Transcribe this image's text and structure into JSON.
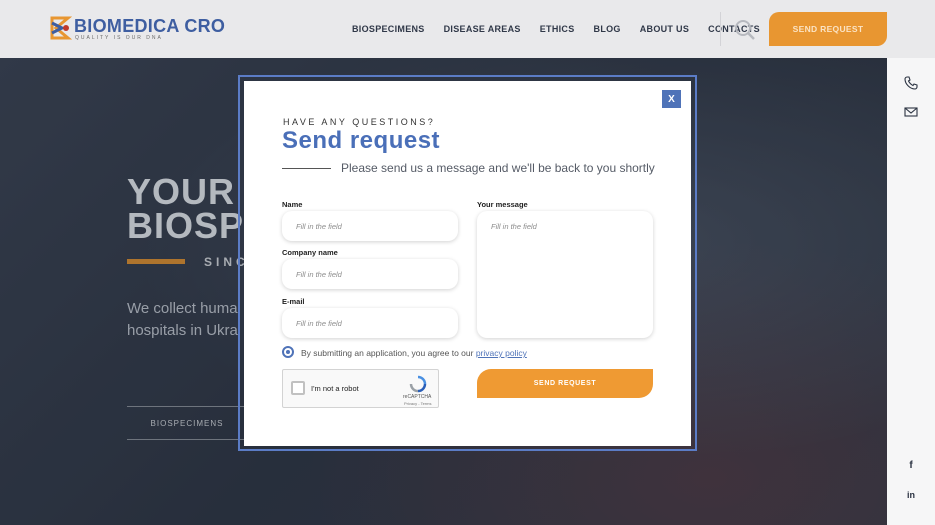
{
  "header": {
    "logo_text": "BIOMEDICA CRO",
    "logo_tagline": "QUALITY IS OUR DNA",
    "nav": [
      "BIOSPECIMENS",
      "DISEASE AREAS",
      "ETHICS",
      "BLOG",
      "ABOUT US",
      "CONTACTS"
    ],
    "send_request_label": "SEND REQUEST"
  },
  "hero": {
    "title_line1": "YOUR",
    "title_line2": "BIOSP",
    "since": "SINC",
    "desc_line1": "We collect huma",
    "desc_line2": "hospitals in Ukra",
    "button_label": "BIOSPECIMENS"
  },
  "rail": {
    "icons": [
      "phone-icon",
      "mail-icon",
      "facebook-icon",
      "linkedin-icon"
    ],
    "facebook_text": "f",
    "linkedin_text": "in"
  },
  "modal": {
    "close_label": "X",
    "eyebrow": "HAVE ANY QUESTIONS?",
    "title": "Send request",
    "subtitle": "Please send us a message and we'll be back to you shortly",
    "fields": {
      "name_label": "Name",
      "name_placeholder": "Fill in the field",
      "company_label": "Company name",
      "company_placeholder": "Fill in the field",
      "email_label": "E-mail",
      "email_placeholder": "Fill in the field",
      "message_label": "Your message",
      "message_placeholder": "Fill in the field"
    },
    "consent_text": "By submitting an application, you agree to our ",
    "consent_link": "privacy policy",
    "captcha_label": "I'm not a robot",
    "captcha_brand": "reCAPTCHA",
    "captcha_terms": "Privacy - Terms",
    "submit_label": "SEND REQUEST"
  },
  "colors": {
    "accent": "#e89631",
    "brand_blue": "#4a6fb8"
  }
}
